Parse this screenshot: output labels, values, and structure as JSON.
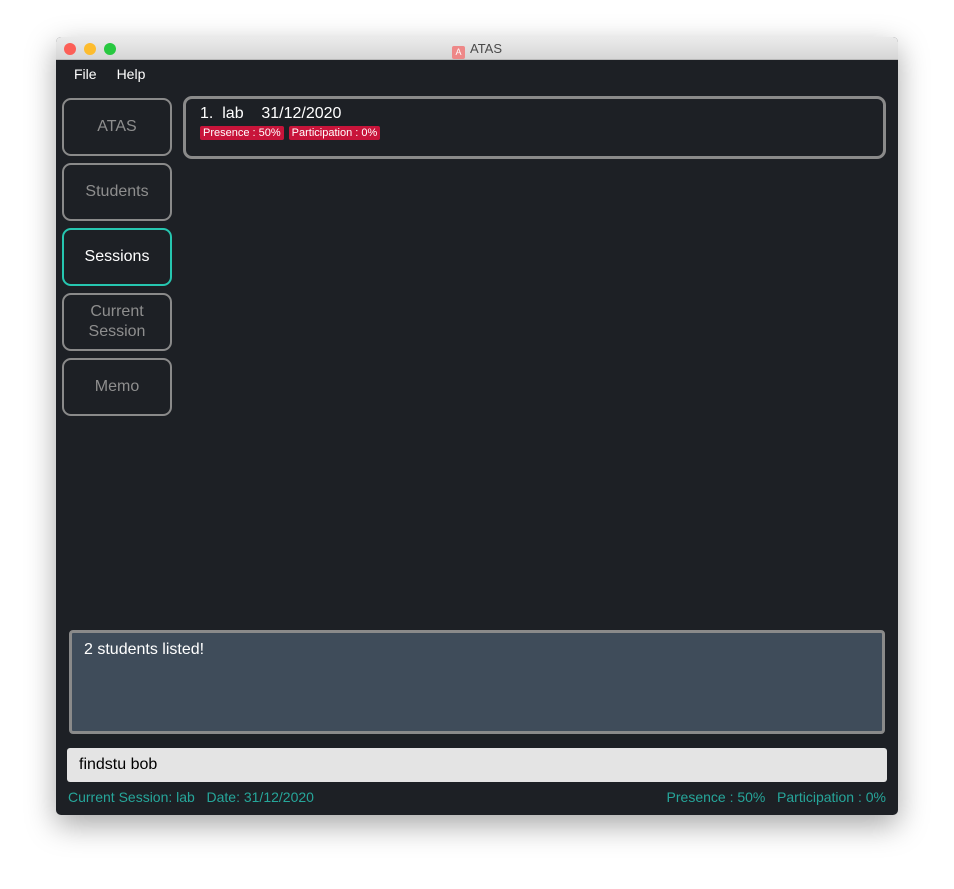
{
  "window": {
    "title": "ATAS",
    "app_icon": "A"
  },
  "menu": [
    "File",
    "Help"
  ],
  "nav": [
    {
      "label": "ATAS"
    },
    {
      "label": "Students"
    },
    {
      "label": "Sessions",
      "active": true
    },
    {
      "label": "Current Session"
    },
    {
      "label": "Memo"
    }
  ],
  "sessions": [
    {
      "index": "1.",
      "name": "lab",
      "date": "31/12/2020",
      "presence": "Presence : 50%",
      "participation": "Participation : 0%"
    }
  ],
  "result_text": "2 students listed!",
  "command": {
    "value": "findstu bob"
  },
  "status": {
    "left": "Current Session: lab   Date: 31/12/2020",
    "right": "Presence : 50%   Participation : 0%"
  },
  "colors": {
    "accent": "#26c6b0",
    "tag": "#c8143a",
    "status_text": "#26a69a",
    "background": "#1d2025"
  }
}
